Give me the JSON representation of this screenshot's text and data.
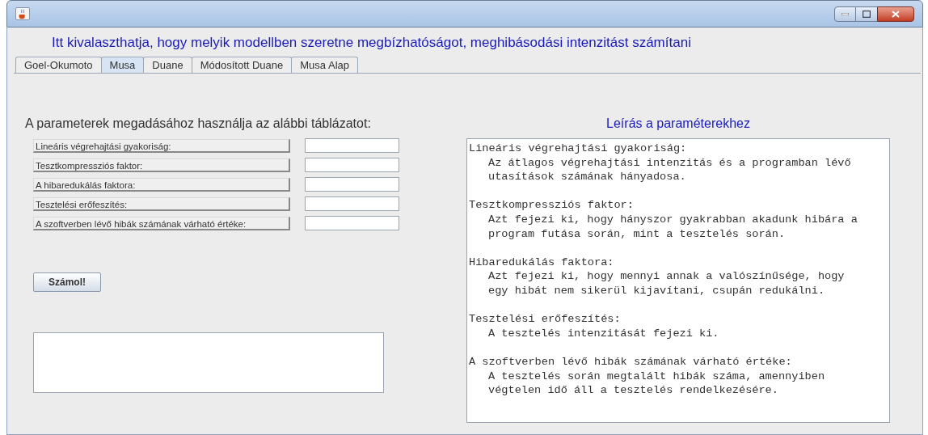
{
  "header": "Itt kivalaszthatja, hogy melyik modellben szeretne megbízhatóságot, meghibásodási intenzitást számítani",
  "tabs": [
    {
      "label": "Goel-Okumoto",
      "selected": false
    },
    {
      "label": "Musa",
      "selected": true
    },
    {
      "label": "Duane",
      "selected": false
    },
    {
      "label": "Módosított Duane",
      "selected": false
    },
    {
      "label": "Musa Alap",
      "selected": false
    }
  ],
  "parameters": {
    "heading": "A parameterek megadásához használja az alábbi táblázatot:",
    "rows": [
      {
        "label": "Lineáris végrehajtási gyakoriság:"
      },
      {
        "label": "Tesztkompressziós faktor:"
      },
      {
        "label": "A hibaredukálás faktora:"
      },
      {
        "label": "Tesztelési erőfeszítés:"
      },
      {
        "label": "A szoftverben lévő hibák számának várható értéke:"
      }
    ],
    "button": "Számol!"
  },
  "description": {
    "heading": "Leírás a paraméterekhez",
    "sections": [
      {
        "title": "Lineáris végrehajtási gyakoriság:",
        "lines": [
          "Az átlagos végrehajtási intenzitás és a programban lévő",
          "utasítások számának hányadosa."
        ]
      },
      {
        "title": "Tesztkompressziós faktor:",
        "lines": [
          "Azt fejezi ki, hogy hányszor gyakrabban akadunk hibára a",
          "program futása során, mint a tesztelés során."
        ]
      },
      {
        "title": "Hibaredukálás faktora:",
        "lines": [
          "Azt fejezi ki, hogy mennyi annak a valószínűsége, hogy",
          "egy hibát nem sikerül kijavítani, csupán redukálni."
        ]
      },
      {
        "title": "Tesztelési erőfeszítés:",
        "lines": [
          "A tesztelés intenzitását fejezi ki."
        ]
      },
      {
        "title": "A szoftverben lévő hibák számának várható értéke:",
        "lines": [
          "A tesztelés során megtalált hibák száma, amennyiben",
          "végtelen idő áll a tesztelés rendelkezésére."
        ]
      }
    ]
  }
}
